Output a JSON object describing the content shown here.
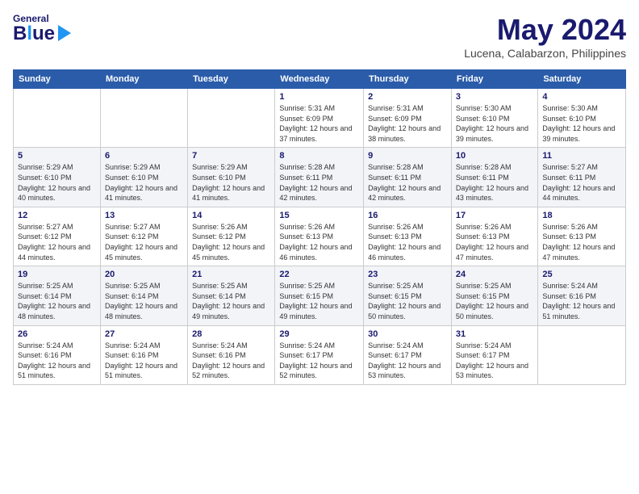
{
  "app": {
    "logo_general": "General",
    "logo_blue": "Blue",
    "month": "May 2024",
    "location": "Lucena, Calabarzon, Philippines"
  },
  "days_of_week": [
    "Sunday",
    "Monday",
    "Tuesday",
    "Wednesday",
    "Thursday",
    "Friday",
    "Saturday"
  ],
  "weeks": [
    [
      {
        "day": "",
        "sunrise": "",
        "sunset": "",
        "daylight": ""
      },
      {
        "day": "",
        "sunrise": "",
        "sunset": "",
        "daylight": ""
      },
      {
        "day": "",
        "sunrise": "",
        "sunset": "",
        "daylight": ""
      },
      {
        "day": "1",
        "sunrise": "Sunrise: 5:31 AM",
        "sunset": "Sunset: 6:09 PM",
        "daylight": "Daylight: 12 hours and 37 minutes."
      },
      {
        "day": "2",
        "sunrise": "Sunrise: 5:31 AM",
        "sunset": "Sunset: 6:09 PM",
        "daylight": "Daylight: 12 hours and 38 minutes."
      },
      {
        "day": "3",
        "sunrise": "Sunrise: 5:30 AM",
        "sunset": "Sunset: 6:10 PM",
        "daylight": "Daylight: 12 hours and 39 minutes."
      },
      {
        "day": "4",
        "sunrise": "Sunrise: 5:30 AM",
        "sunset": "Sunset: 6:10 PM",
        "daylight": "Daylight: 12 hours and 39 minutes."
      }
    ],
    [
      {
        "day": "5",
        "sunrise": "Sunrise: 5:29 AM",
        "sunset": "Sunset: 6:10 PM",
        "daylight": "Daylight: 12 hours and 40 minutes."
      },
      {
        "day": "6",
        "sunrise": "Sunrise: 5:29 AM",
        "sunset": "Sunset: 6:10 PM",
        "daylight": "Daylight: 12 hours and 41 minutes."
      },
      {
        "day": "7",
        "sunrise": "Sunrise: 5:29 AM",
        "sunset": "Sunset: 6:10 PM",
        "daylight": "Daylight: 12 hours and 41 minutes."
      },
      {
        "day": "8",
        "sunrise": "Sunrise: 5:28 AM",
        "sunset": "Sunset: 6:11 PM",
        "daylight": "Daylight: 12 hours and 42 minutes."
      },
      {
        "day": "9",
        "sunrise": "Sunrise: 5:28 AM",
        "sunset": "Sunset: 6:11 PM",
        "daylight": "Daylight: 12 hours and 42 minutes."
      },
      {
        "day": "10",
        "sunrise": "Sunrise: 5:28 AM",
        "sunset": "Sunset: 6:11 PM",
        "daylight": "Daylight: 12 hours and 43 minutes."
      },
      {
        "day": "11",
        "sunrise": "Sunrise: 5:27 AM",
        "sunset": "Sunset: 6:11 PM",
        "daylight": "Daylight: 12 hours and 44 minutes."
      }
    ],
    [
      {
        "day": "12",
        "sunrise": "Sunrise: 5:27 AM",
        "sunset": "Sunset: 6:12 PM",
        "daylight": "Daylight: 12 hours and 44 minutes."
      },
      {
        "day": "13",
        "sunrise": "Sunrise: 5:27 AM",
        "sunset": "Sunset: 6:12 PM",
        "daylight": "Daylight: 12 hours and 45 minutes."
      },
      {
        "day": "14",
        "sunrise": "Sunrise: 5:26 AM",
        "sunset": "Sunset: 6:12 PM",
        "daylight": "Daylight: 12 hours and 45 minutes."
      },
      {
        "day": "15",
        "sunrise": "Sunrise: 5:26 AM",
        "sunset": "Sunset: 6:13 PM",
        "daylight": "Daylight: 12 hours and 46 minutes."
      },
      {
        "day": "16",
        "sunrise": "Sunrise: 5:26 AM",
        "sunset": "Sunset: 6:13 PM",
        "daylight": "Daylight: 12 hours and 46 minutes."
      },
      {
        "day": "17",
        "sunrise": "Sunrise: 5:26 AM",
        "sunset": "Sunset: 6:13 PM",
        "daylight": "Daylight: 12 hours and 47 minutes."
      },
      {
        "day": "18",
        "sunrise": "Sunrise: 5:26 AM",
        "sunset": "Sunset: 6:13 PM",
        "daylight": "Daylight: 12 hours and 47 minutes."
      }
    ],
    [
      {
        "day": "19",
        "sunrise": "Sunrise: 5:25 AM",
        "sunset": "Sunset: 6:14 PM",
        "daylight": "Daylight: 12 hours and 48 minutes."
      },
      {
        "day": "20",
        "sunrise": "Sunrise: 5:25 AM",
        "sunset": "Sunset: 6:14 PM",
        "daylight": "Daylight: 12 hours and 48 minutes."
      },
      {
        "day": "21",
        "sunrise": "Sunrise: 5:25 AM",
        "sunset": "Sunset: 6:14 PM",
        "daylight": "Daylight: 12 hours and 49 minutes."
      },
      {
        "day": "22",
        "sunrise": "Sunrise: 5:25 AM",
        "sunset": "Sunset: 6:15 PM",
        "daylight": "Daylight: 12 hours and 49 minutes."
      },
      {
        "day": "23",
        "sunrise": "Sunrise: 5:25 AM",
        "sunset": "Sunset: 6:15 PM",
        "daylight": "Daylight: 12 hours and 50 minutes."
      },
      {
        "day": "24",
        "sunrise": "Sunrise: 5:25 AM",
        "sunset": "Sunset: 6:15 PM",
        "daylight": "Daylight: 12 hours and 50 minutes."
      },
      {
        "day": "25",
        "sunrise": "Sunrise: 5:24 AM",
        "sunset": "Sunset: 6:16 PM",
        "daylight": "Daylight: 12 hours and 51 minutes."
      }
    ],
    [
      {
        "day": "26",
        "sunrise": "Sunrise: 5:24 AM",
        "sunset": "Sunset: 6:16 PM",
        "daylight": "Daylight: 12 hours and 51 minutes."
      },
      {
        "day": "27",
        "sunrise": "Sunrise: 5:24 AM",
        "sunset": "Sunset: 6:16 PM",
        "daylight": "Daylight: 12 hours and 51 minutes."
      },
      {
        "day": "28",
        "sunrise": "Sunrise: 5:24 AM",
        "sunset": "Sunset: 6:16 PM",
        "daylight": "Daylight: 12 hours and 52 minutes."
      },
      {
        "day": "29",
        "sunrise": "Sunrise: 5:24 AM",
        "sunset": "Sunset: 6:17 PM",
        "daylight": "Daylight: 12 hours and 52 minutes."
      },
      {
        "day": "30",
        "sunrise": "Sunrise: 5:24 AM",
        "sunset": "Sunset: 6:17 PM",
        "daylight": "Daylight: 12 hours and 53 minutes."
      },
      {
        "day": "31",
        "sunrise": "Sunrise: 5:24 AM",
        "sunset": "Sunset: 6:17 PM",
        "daylight": "Daylight: 12 hours and 53 minutes."
      },
      {
        "day": "",
        "sunrise": "",
        "sunset": "",
        "daylight": ""
      }
    ]
  ]
}
